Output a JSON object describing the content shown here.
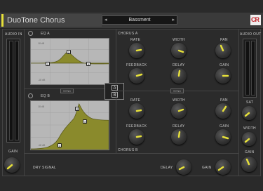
{
  "header": {
    "title": "DuoTone Chorus",
    "preset": "Bassment",
    "logo": "CR",
    "accent_color": "#e6e03a"
  },
  "left": {
    "audio_in_label": "AUDIO IN",
    "gain_label": "GAIN"
  },
  "right": {
    "audio_out_label": "AUDIO OUT",
    "sat_label": "SAT",
    "width_label": "WIDTH",
    "gain_label": "GAIN"
  },
  "eq_a": {
    "title": "EQ A",
    "db_top": "18 dB",
    "db_bottom": "-18 dB",
    "node_labels": [
      "1",
      "2",
      "3"
    ],
    "sync_label": "SYNC"
  },
  "eq_b": {
    "title": "EQ B",
    "db_top": "18 dB",
    "db_bottom": "-18 dB",
    "node_labels": [
      "1",
      "2",
      "3"
    ]
  },
  "chorus_a": {
    "title": "CHORUS A",
    "rate_label": "RATE",
    "width_label": "WIDTH",
    "pan_label": "PAN",
    "feedback_label": "FEEDBACK",
    "delay_label": "DELAY",
    "gain_label": "GAIN",
    "sync_label": "SYNC"
  },
  "chorus_b": {
    "title": "CHORUS B",
    "rate_label": "RATE",
    "width_label": "WIDTH",
    "pan_label": "PAN",
    "feedback_label": "FEEDBACK",
    "delay_label": "DELAY",
    "gain_label": "GAIN"
  },
  "ab": {
    "a_label": "A",
    "b_label": "B"
  },
  "dry": {
    "title": "DRY SIGNAL",
    "delay_label": "DELAY",
    "gain_label": "GAIN"
  }
}
